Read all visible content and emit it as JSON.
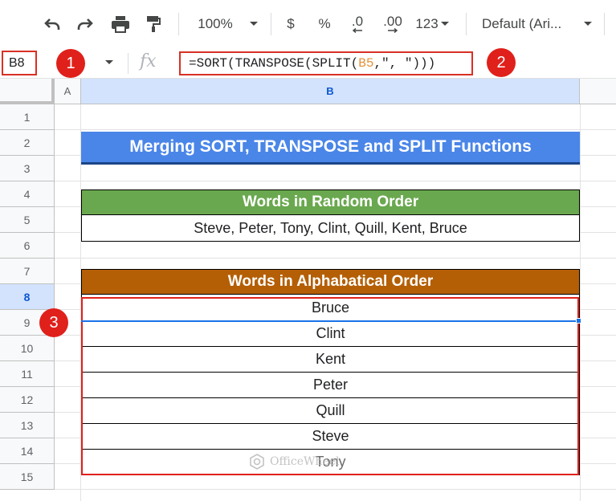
{
  "toolbar": {
    "zoom": "100%",
    "currency": "$",
    "percent": "%",
    "dec_decrease": ".0",
    "dec_increase": ".00",
    "number_format": "123",
    "font": "Default (Ari..."
  },
  "formula_bar": {
    "name_box": "B8",
    "fx": "fx",
    "formula_prefix": "=SORT(TRANSPOSE(SPLIT(",
    "formula_ref": "B5",
    "formula_suffix": ",\", \")))"
  },
  "badges": [
    "1",
    "2",
    "3"
  ],
  "columns": [
    "A",
    "B"
  ],
  "rows": [
    "1",
    "2",
    "3",
    "4",
    "5",
    "6",
    "7",
    "8",
    "9",
    "10",
    "11",
    "12",
    "13",
    "14",
    "15"
  ],
  "sheet": {
    "title": "Merging SORT, TRANSPOSE and SPLIT Functions",
    "random_header": "Words in Random Order",
    "random_value": "Steve, Peter, Tony, Clint, Quill, Kent, Bruce",
    "sorted_header": "Words in Alphabatical Order",
    "sorted_values": [
      "Bruce",
      "Clint",
      "Kent",
      "Peter",
      "Quill",
      "Steve",
      "Tony"
    ]
  },
  "watermark": "OfficeWheel",
  "colors": {
    "title_bg": "#4a86e8",
    "green_header": "#6aa84f",
    "brown_header": "#b45f06",
    "highlight_red": "#e0201b",
    "selection_blue": "#1a73e8"
  }
}
